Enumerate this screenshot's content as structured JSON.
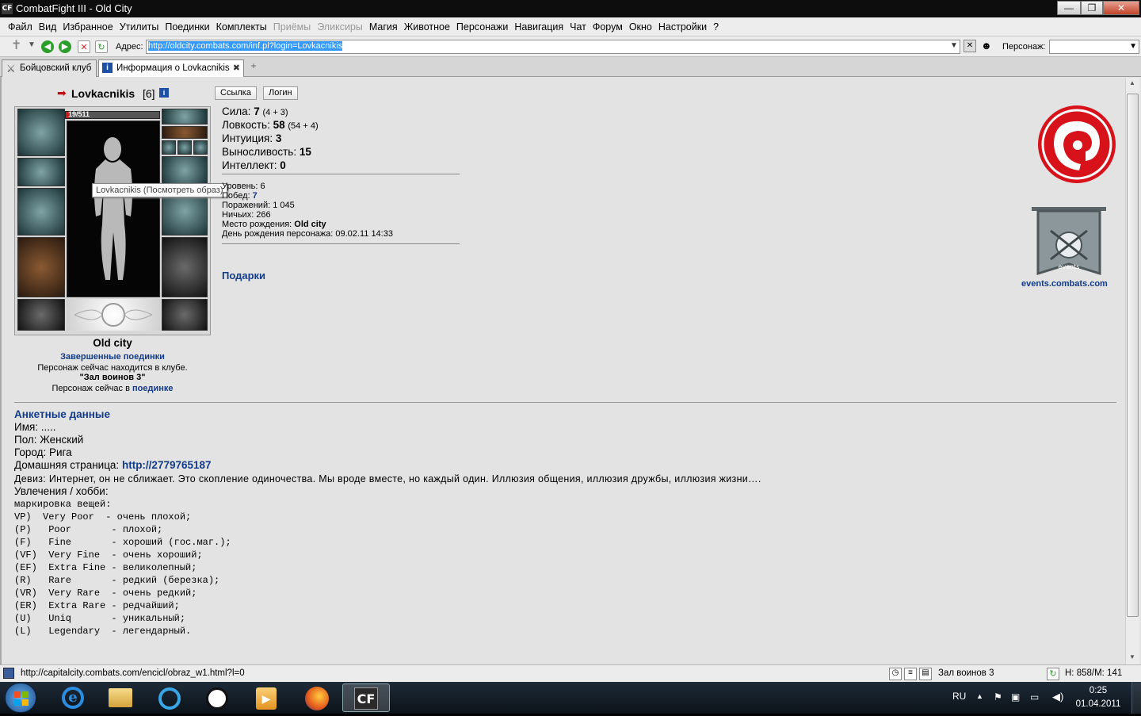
{
  "window": {
    "app_icon": "CF",
    "title": "CombatFight III - Old City",
    "minimize": "—",
    "maximize": "❐",
    "close": "✕"
  },
  "menu": [
    "Файл",
    "Вид",
    "Избранное",
    "Утилиты",
    "Поединки",
    "Комплекты",
    "Приёмы",
    "Эликсиры",
    "Магия",
    "Животное",
    "Персонажи",
    "Навигация",
    "Чат",
    "Форум",
    "Окно",
    "Настройки",
    "?"
  ],
  "menu_disabled": [
    "Приёмы",
    "Эликсиры"
  ],
  "address": {
    "label": "Адрес:",
    "url": "http://oldcity.combats.com/inf.pl?login=Lovkacnikis",
    "character_label": "Персонаж:"
  },
  "tabs": [
    {
      "label": "Бойцовский клуб",
      "active": false
    },
    {
      "label": "Информация о Lovkacnikis",
      "active": true
    }
  ],
  "profile": {
    "name": "Lovkacnikis",
    "level": "[6]",
    "hp": "19/511",
    "tooltip": "Lovkacnikis (Посмотреть образ)",
    "city": "Old city",
    "finished_fights": "Завершенные поединки",
    "location_line": "Персонаж сейчас находится в клубе.",
    "room": "\"Зал воинов 3\"",
    "fight_line_prefix": "Персонаж сейчас в",
    "fight_link": "поединке",
    "buttons": {
      "link": "Ссылка",
      "login": "Логин"
    }
  },
  "stats": [
    {
      "label": "Сила:",
      "value": "7",
      "detail": "(4 + 3)"
    },
    {
      "label": "Ловкость:",
      "value": "58",
      "detail": "(54 + 4)"
    },
    {
      "label": "Интуиция:",
      "value": "3",
      "detail": ""
    },
    {
      "label": "Выносливость:",
      "value": "15",
      "detail": ""
    },
    {
      "label": "Интеллект:",
      "value": "0",
      "detail": ""
    }
  ],
  "info": {
    "level_label": "Уровень:",
    "level_value": "6",
    "wins_label": "Побед:",
    "wins_value": "7",
    "losses": "Поражений: 1 045",
    "draws": "Ничьих: 266",
    "birthplace_label": "Место рождения:",
    "birthplace_value": "Old city",
    "birthday": "День рождения персонажа: 09.02.11 14:33",
    "gifts": "Подарки"
  },
  "events_link": "events.combats.com",
  "banner_text": "events",
  "anketa": {
    "title": "Анкетные данные",
    "name": "Имя: .....",
    "gender": "Пол: Женский",
    "city": "Город: Рига",
    "homepage_label": "Домашняя страница:",
    "homepage_value": "http://2779765187",
    "motto": "Девиз: Интернет, он не сближает. Это скопление одиночества. Мы вроде вместе, но каждый один. Иллюзия общения, иллюзия дружбы, иллюзия жизни….",
    "hobby": "Увлечения / хобби:",
    "marking": "маркировка вещей:",
    "grades": [
      "VP)  Very Poor  - очень плохой;",
      "(P)   Poor       - плохой;",
      "(F)   Fine       - хороший (гос.маг.);",
      "(VF)  Very Fine  - очень хороший;",
      "(EF)  Extra Fine - великолепный;",
      "(R)   Rare       - редкий (березка);",
      "(VR)  Very Rare  - очень редкий;",
      "(ER)  Extra Rare - редчайший;",
      "(U)   Uniq       - уникальный;",
      "(L)   Legendary  - легендарный."
    ]
  },
  "status": {
    "url": "http://capitalcity.combats.com/encicl/obraz_w1.html?l=0",
    "room": "Зал воинов 3",
    "hp": "H: 858/M: 141"
  },
  "tray": {
    "lang": "RU",
    "time": "0:25",
    "date": "01.04.2011"
  },
  "colors": {
    "link": "#123b8a",
    "emblem_red": "#d8121a",
    "selection": "#3399ff"
  }
}
